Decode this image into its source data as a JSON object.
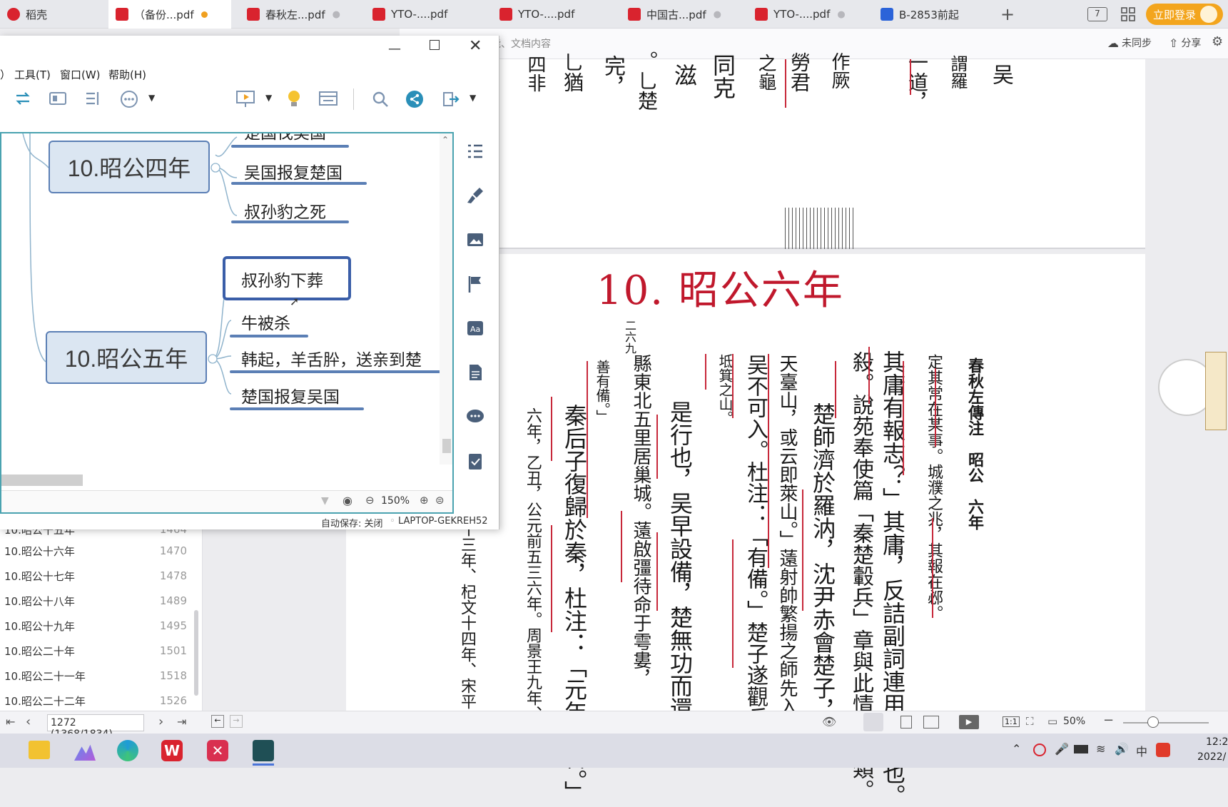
{
  "tabs": [
    {
      "label": "稻壳",
      "color": "#d9232e"
    },
    {
      "label": "（备份...pdf",
      "color": "#d9232e",
      "dot": "#f0a020",
      "active": true
    },
    {
      "label": "春秋左...pdf",
      "color": "#d9232e"
    },
    {
      "label": "YTO-....pdf",
      "color": "#d9232e"
    },
    {
      "label": "YTO-....pdf",
      "color": "#d9232e"
    },
    {
      "label": "中国古...pdf",
      "color": "#d9232e"
    },
    {
      "label": "YTO-....pdf",
      "color": "#d9232e"
    },
    {
      "label": "B-2853前起",
      "color": "#2b63d9"
    }
  ],
  "topbar": {
    "page_num_badge": "7",
    "login_label": "立即登录",
    "sync_label": "未同步",
    "share_label": "分享",
    "search_hint": "能、文档内容"
  },
  "xmind": {
    "menu": [
      "）",
      "工具(T)",
      "窗口(W)",
      "帮助(H)"
    ],
    "topics": [
      {
        "label": "10.昭公四年",
        "subs": [
          "楚国伐吴国",
          "吴国报复楚国",
          "叔孙豹之死"
        ]
      },
      {
        "label": "10.昭公五年",
        "subs": [
          "叔孙豹下葬",
          "牛被杀",
          "韩起，羊舌肸，送亲到楚",
          "楚国报复吴国"
        ]
      }
    ],
    "zoom": "150%",
    "autosave": "自动保存: 关闭",
    "device": "LAPTOP-GEKREH52"
  },
  "sidebar": {
    "items": [
      {
        "label": "10.昭公十五年",
        "page": "1464"
      },
      {
        "label": "10.昭公十六年",
        "page": "1470"
      },
      {
        "label": "10.昭公十七年",
        "page": "1478"
      },
      {
        "label": "10.昭公十八年",
        "page": "1489"
      },
      {
        "label": "10.昭公十九年",
        "page": "1495"
      },
      {
        "label": "10.昭公二十年",
        "page": "1501"
      },
      {
        "label": "10.昭公二十一年",
        "page": "1518"
      },
      {
        "label": "10.昭公二十二年",
        "page": "1526"
      }
    ]
  },
  "document": {
    "title": "10. 昭公六年",
    "top_fragments": [
      "四非",
      "乚猶",
      "完，",
      "。乚楚",
      "滋",
      "同克",
      "之龜",
      "勞君",
      "作厥",
      "一道，",
      "謂羅",
      "吴"
    ],
    "page_number_marker": "二六九",
    "header_vertical": "春秋左傳注　昭公　六年",
    "columns": [
      "定其常在某事。城濮之兆，其報在邲。",
      "其庸有報志？」其庸，反詰副詞連用，豈也。",
      "殺。說苑奉使篇「秦楚轂兵」章與此情節相類。",
      "楚師濟於羅汭，沈尹赤會楚子，",
      "天臺山，或云即萊山。」薳射帥繁揚之師先入",
      "吴不可入。杜注：「有備。」楚子遂觀兵於",
      "坻箕之山。",
      "是行也，吴早設備，楚無功而還，",
      "縣東北五里居巢城。薳啟彊待命于雩婁，",
      "善有備。」",
      "秦后子復歸於秦，杜注：「元年奔晉。」",
      "六年，乙丑，公元前五三六年。周景王九年、",
      "十九年、陳哀三十三年、杞文十四年、宋平"
    ]
  },
  "status": {
    "page_input": "1272 (1368/1834)",
    "zoom": "50%"
  },
  "taskbar": {
    "time": "12:2",
    "date": "2022/",
    "ime": "中"
  }
}
